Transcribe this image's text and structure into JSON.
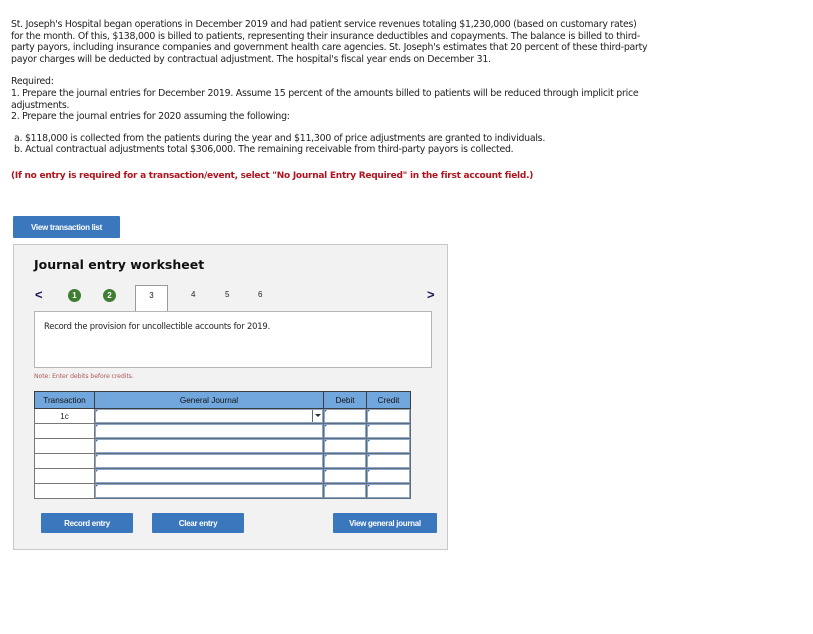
{
  "problem": {
    "intro": "St. Joseph's Hospital began operations in December 2019 and had patient service revenues totaling $1,230,000 (based on customary rates) for the month. Of this, $138,000 is billed to patients, representing their insurance deductibles and copayments. The balance is billed to third-party payors, including insurance companies and government health care agencies. St. Joseph's estimates that 20 percent of these third-party payor charges will be deducted by contractual adjustment. The hospital's fiscal year ends on December 31.",
    "required_heading": "Required:",
    "req1": "1. Prepare the journal entries for December 2019. Assume 15 percent of the amounts billed to patients will be reduced through implicit price adjustments.",
    "req2": "2. Prepare the journal entries for 2020 assuming the following:",
    "req2a": "a. $118,000 is collected from the patients during the year and $11,300 of price adjustments are granted to individuals.",
    "req2b": "b. Actual contractual adjustments total $306,000. The remaining receivable from third-party payors is collected.",
    "instruction": "(If no entry is required for a transaction/event, select \"No Journal Entry Required\" in the first account field.)"
  },
  "buttons": {
    "view_transaction_list": "View transaction list",
    "record_entry": "Record entry",
    "clear_entry": "Clear entry",
    "view_general_journal": "View general journal"
  },
  "worksheet": {
    "title": "Journal entry worksheet",
    "prev": "<",
    "next": ">",
    "steps": [
      {
        "label": "1",
        "status": "completed"
      },
      {
        "label": "2",
        "status": "completed"
      },
      {
        "label": "3",
        "status": "current"
      },
      {
        "label": "4",
        "status": "pending"
      },
      {
        "label": "5",
        "status": "pending"
      },
      {
        "label": "6",
        "status": "pending"
      }
    ],
    "description": "Record the provision for uncollectible accounts for 2019.",
    "note": "Note: Enter debits before credits."
  },
  "table": {
    "headers": [
      "Transaction",
      "General Journal",
      "Debit",
      "Credit"
    ],
    "rows": [
      {
        "transaction": "1c",
        "account": "",
        "debit": "",
        "credit": ""
      },
      {
        "transaction": "",
        "account": "",
        "debit": "",
        "credit": ""
      },
      {
        "transaction": "",
        "account": "",
        "debit": "",
        "credit": ""
      },
      {
        "transaction": "",
        "account": "",
        "debit": "",
        "credit": ""
      },
      {
        "transaction": "",
        "account": "",
        "debit": "",
        "credit": ""
      },
      {
        "transaction": "",
        "account": "",
        "debit": "",
        "credit": ""
      }
    ]
  },
  "colors": {
    "button": "#3a77bd",
    "step_completed": "#3f7d33",
    "header_bg": "#72a7de",
    "instruction_red": "#b0141e"
  }
}
